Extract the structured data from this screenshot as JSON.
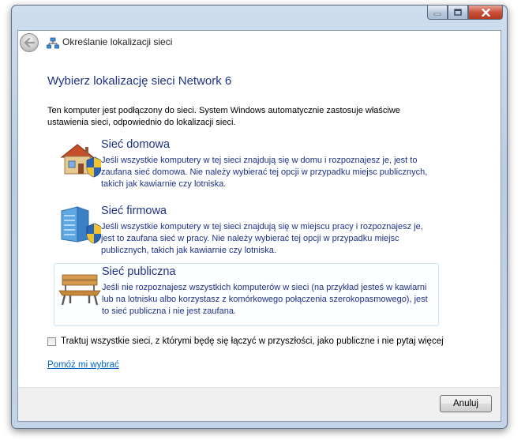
{
  "window": {
    "title": "Określanie lokalizacji sieci",
    "buttons": [
      "minimize-icon",
      "maximize-icon",
      "close-icon"
    ]
  },
  "heading": "Wybierz lokalizację sieci Network  6",
  "intro": "Ten komputer jest podłączony do sieci. System Windows automatycznie zastosuje właściwe ustawienia sieci, odpowiednio do lokalizacji sieci.",
  "options": [
    {
      "title": "Sieć domowa",
      "description": "Jeśli wszystkie komputery w tej sieci znajdują się w domu i rozpoznajesz je, jest to zaufana sieć domowa. Nie należy wybierać tej opcji w przypadku miejsc publicznych, takich jak kawiarnie czy lotniska.",
      "icon": "house-shield-icon"
    },
    {
      "title": "Sieć firmowa",
      "description": "Jeśli wszystkie komputery w tej sieci znajdują się w miejscu pracy i rozpoznajesz je, jest to zaufana sieć w pracy. Nie należy wybierać tej opcji w przypadku miejsc publicznych, takich jak kawiarnie czy lotniska.",
      "icon": "office-building-shield-icon"
    },
    {
      "title": "Sieć publiczna",
      "description": "Jeśli nie rozpoznajesz wszystkich komputerów w sieci (na przykład jesteś w kawiarni lub na lotnisku albo korzystasz z komórkowego połączenia szerokopasmowego), jest to sieć publiczna i nie jest zaufana.",
      "icon": "park-bench-icon"
    }
  ],
  "checkbox": {
    "label": "Traktuj wszystkie sieci, z którymi będę się łączyć w przyszłości, jako publiczne i nie pytaj więcej",
    "checked": false
  },
  "help_link": "Pomóż mi wybrać",
  "cancel_label": "Anuluj",
  "colors": {
    "heading": "#1e3287",
    "link": "#0066cc",
    "footer": "#f0f0f0"
  }
}
